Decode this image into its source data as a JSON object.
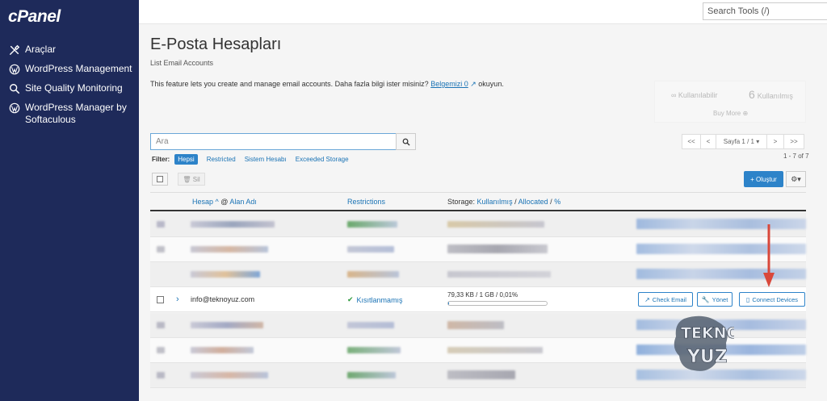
{
  "sidebar": {
    "logo": "cPanel",
    "items": [
      {
        "label": "Araçlar",
        "icon": "tools-icon"
      },
      {
        "label": "WordPress Management",
        "icon": "wordpress-icon"
      },
      {
        "label": "Site Quality Monitoring",
        "icon": "search-icon"
      },
      {
        "label": "WordPress Manager by Softaculous",
        "icon": "wordpress-icon"
      }
    ]
  },
  "topbar": {
    "search_placeholder": "Search Tools (/)"
  },
  "page": {
    "title": "E-Posta Hesapları",
    "subtitle": "List Email Accounts",
    "intro_text": "This feature lets you create and manage email accounts. Daha fazla bilgi ister misiniz?",
    "intro_link": "Belgemizi 0",
    "intro_tail": "okuyun."
  },
  "stats": {
    "available_label": "Kullanılabilir",
    "used_count": "6",
    "used_label": "Kullanılmış",
    "more_label": "Buy More"
  },
  "search": {
    "placeholder": "Ara"
  },
  "pagination": {
    "first": "<<",
    "prev": "<",
    "page_label": "Sayfa 1 / 1",
    "next": ">",
    "last": ">>",
    "count": "1 - 7 of 7"
  },
  "filter": {
    "label": "Filter:",
    "options": [
      "Hepsi",
      "Restricted",
      "Sistem Hesabı",
      "Exceeded Storage"
    ],
    "active": "Hepsi"
  },
  "toolbar": {
    "delete_label": "Sil",
    "create_label": "Oluştur"
  },
  "table": {
    "col_account": "Hesap",
    "col_at": "@",
    "col_domain": "Alan Adı",
    "col_restrictions": "Restrictions",
    "col_storage_prefix": "Storage:",
    "col_used": "Kullanılmış",
    "col_allocated": "Allocated",
    "col_percent": "%"
  },
  "focus_row": {
    "email": "info@teknoyuz.com",
    "restriction": "Kısıtlanmamış",
    "storage": "79,33 KB / 1 GB / 0,01%",
    "storage_fraction": 0.0001,
    "check_email": "Check Email",
    "manage": "Yönet",
    "connect": "Connect Devices"
  },
  "colors": {
    "sidebar": "#1e2a5a",
    "accent": "#2d83c9",
    "arrow": "#d9483b",
    "ok": "#2e9a3d"
  }
}
